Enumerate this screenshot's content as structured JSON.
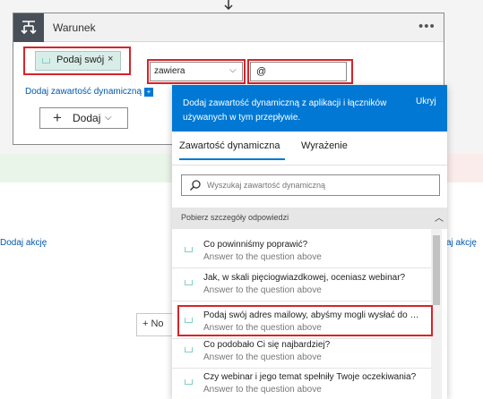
{
  "condition_card": {
    "title": "Warunek",
    "more_icon": "ellipsis-icon",
    "operand_token": {
      "label": "Podaj swój",
      "remove": "×"
    },
    "operator": {
      "value": "zawiera",
      "chevron": "⌵"
    },
    "value_input": "@",
    "dynamic_link": "Dodaj zawartość dynamiczną",
    "dynamic_badge": "+",
    "add_button": {
      "label": "Dodaj",
      "plus": "+",
      "chevron": "⌵"
    }
  },
  "background": {
    "add_action_left": "Dodaj akcję",
    "add_action_right": "aj akcję",
    "new_step": "+ No"
  },
  "dynamic_panel": {
    "description": "Dodaj zawartość dynamiczną z aplikacji i łączników używanych w tym przepływie.",
    "hide": "Ukryj",
    "tabs": [
      {
        "label": "Zawartość dynamiczna",
        "active": true
      },
      {
        "label": "Wyrażenie",
        "active": false
      }
    ],
    "search_placeholder": "Wyszukaj zawartość dynamiczną",
    "section_label": "Pobierz szczegóły odpowiedzi",
    "section_chevron": "︿",
    "items": [
      {
        "title": "Co powinniśmy poprawić?",
        "subtitle": "Answer to the question above"
      },
      {
        "title": "Jak, w skali pięciogwiazdkowej, oceniasz webinar?",
        "subtitle": "Answer to the question above"
      },
      {
        "title": "Podaj swój adres mailowy, abyśmy mogli wysłać do …",
        "subtitle": "Answer to the question above"
      },
      {
        "title": "Co podobało Ci się najbardziej?",
        "subtitle": "Answer to the question above"
      },
      {
        "title": "Czy webinar i jego temat spełniły Twoje oczekiwania?",
        "subtitle": "Answer to the question above"
      }
    ]
  },
  "colors": {
    "accent": "#0078d4",
    "highlight": "#d8232a",
    "token_bg": "#d9ede8"
  }
}
